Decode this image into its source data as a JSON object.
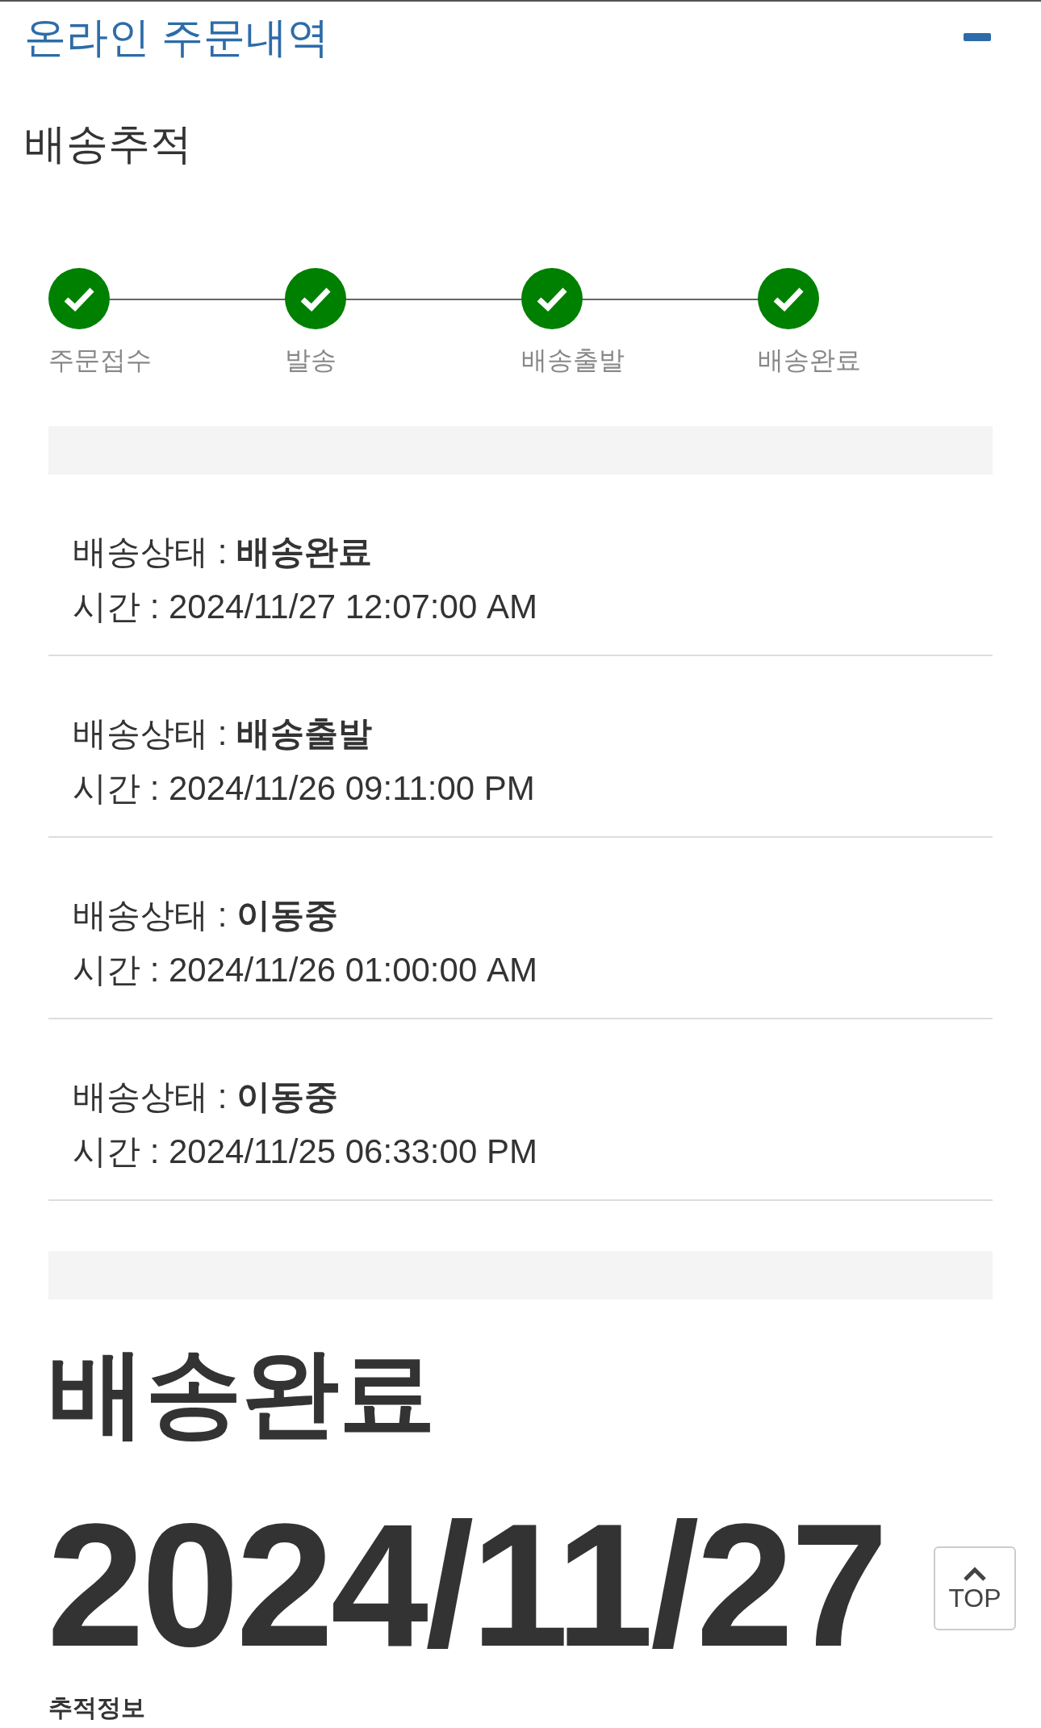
{
  "panel": {
    "title": "온라인 주문내역",
    "expanded": true
  },
  "section_title": "배송추적",
  "steps": [
    {
      "label": "주문접수",
      "done": true
    },
    {
      "label": "발송",
      "done": true
    },
    {
      "label": "배송출발",
      "done": true
    },
    {
      "label": "배송완료",
      "done": true
    }
  ],
  "history": [
    {
      "status": "배송상태 : **배송완료**",
      "time": "시간 : 2024/11/27 12:07:00 AM"
    },
    {
      "status": "배송상태 : **배송출발**",
      "time": "시간 : 2024/11/26 09:11:00 PM"
    },
    {
      "status": "배송상태 : **이동중**",
      "time": "시간 : 2024/11/26 01:00:00 AM"
    },
    {
      "status": "배송상태 : **이동중**",
      "time": "시간 : 2024/11/25 06:33:00 PM"
    }
  ],
  "summary": {
    "status": "배송완료",
    "date": "2024/11/27"
  },
  "next_heading": "추적정보",
  "top_button": {
    "label": "TOP"
  }
}
